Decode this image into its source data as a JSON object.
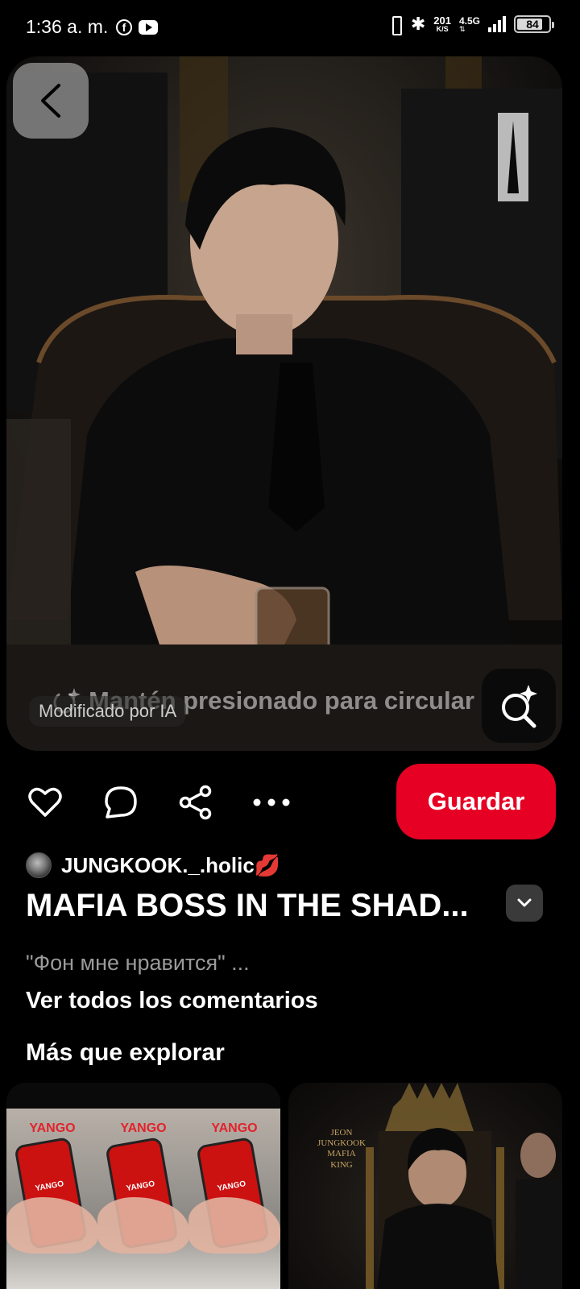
{
  "status_bar": {
    "time": "1:36 a. m.",
    "app_icons": [
      "facebook-icon",
      "youtube-icon"
    ],
    "net_speed_value": "201",
    "net_speed_unit": "K/S",
    "network_type": "4.5G",
    "network_arrows": "⇅",
    "battery_level": "84"
  },
  "pin": {
    "image_alt": "Man in black suit seated in leather chair holding a glass",
    "circle_hint": "Mantén presionado para circular",
    "ai_badge": "Modificado por IA",
    "author": "JUNGKOOK._.holic💋",
    "title": "MAFIA BOSS IN THE SHAD...",
    "comment_preview": "\"Фон мне нравится\" ...",
    "all_comments_link": "Ver todos los comentarios"
  },
  "actions": {
    "save_label": "Guardar",
    "icons": [
      "heart-icon",
      "comment-icon",
      "share-icon",
      "more-icon"
    ]
  },
  "explore": {
    "heading": "Más que explorar",
    "tile_left_brand": "YANGO",
    "tile_right_text": "JEON JUNGKOOK MAFIA KING"
  },
  "colors": {
    "accent": "#e60023",
    "background": "#000000",
    "secondary_text": "#9a9a9a"
  }
}
